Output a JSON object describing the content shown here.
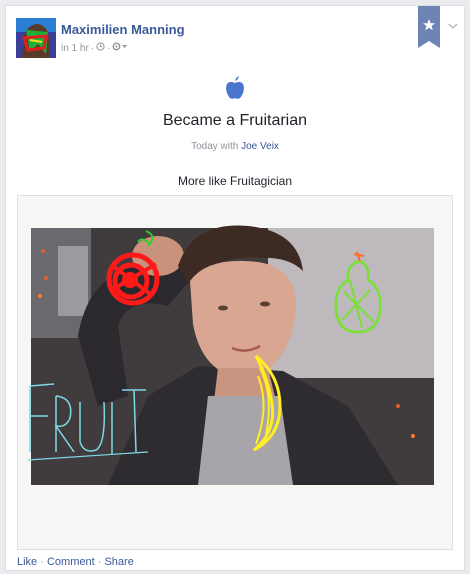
{
  "post": {
    "author": "Maximilien Manning",
    "time": "in 1 hr",
    "separator": "·"
  },
  "life_event": {
    "icon": "apple-icon",
    "title": "Became a Fruitarian",
    "date_text": "Today with",
    "with_person": "Joe Veix",
    "caption": "More like Fruitagician"
  },
  "photo": {
    "doodle_text": "FRUIT"
  },
  "actions": {
    "like": "Like",
    "comment": "Comment",
    "share": "Share",
    "dot": "·"
  },
  "colors": {
    "link": "#3b5998",
    "ribbon": "#6d84b4",
    "apple_icon": "#4a76d0"
  }
}
